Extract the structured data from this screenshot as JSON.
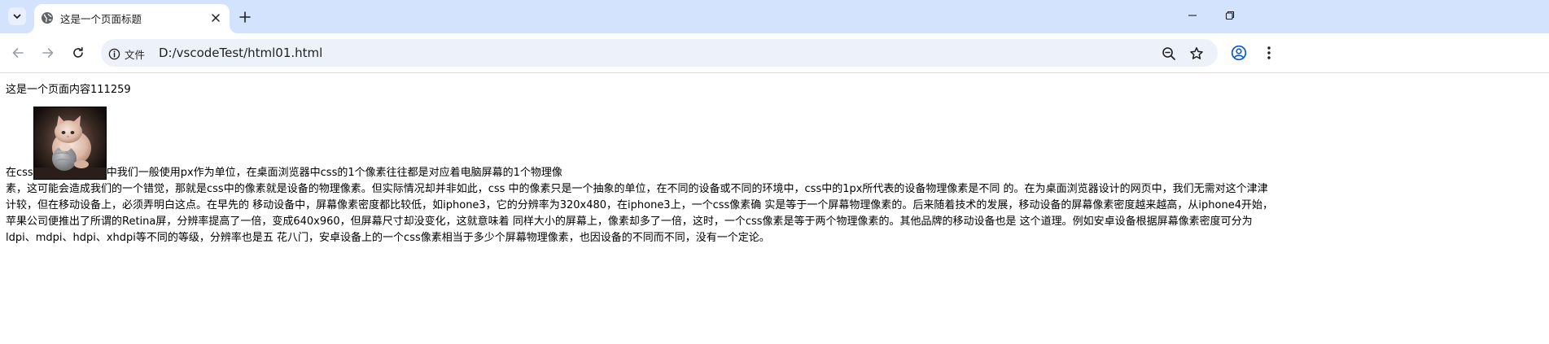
{
  "browser": {
    "tab": {
      "title": "这是一个页面标题"
    },
    "address_bar": {
      "site_label": "文件",
      "url": "D:/vscodeTest/html01.html"
    },
    "icons": {
      "tab_search": "chevron-down-icon",
      "favicon": "globe-icon",
      "close_tab": "close-icon",
      "new_tab": "plus-icon",
      "minimize": "minimize-icon",
      "restore": "restore-icon",
      "back": "arrow-left-icon",
      "forward": "arrow-right-icon",
      "reload": "reload-icon",
      "site_info": "info-icon",
      "zoom": "zoom-out-icon",
      "bookmark": "star-icon",
      "profile": "account-icon",
      "menu": "kebab-menu-icon"
    },
    "colors": {
      "tabstrip_bg": "#d3e3fd",
      "omnibox_bg": "#edf2fa"
    }
  },
  "page": {
    "heading_text": "这是一个页面内容111259",
    "paragraph": {
      "lead": "在css",
      "after_image": "中我们一般使用px作为单位，在桌面浏览器中css的1个像素往往都是对应着电脑屏幕的1个物理像",
      "lines": [
        "素，这可能会造成我们的一个错觉，那就是css中的像素就是设备的物理像素。但实际情况却并非如此，css 中的像素只是一个抽象的单位，在不同的设备或不同的环境中，css中的1px所代表的设备物理像素是不同 的。在为桌面浏览器设计的网页中，我们无需对这个津津",
        "计较，但在移动设备上，必须弄明白这点。在早先的 移动设备中，屏幕像素密度都比较低，如iphone3，它的分辨率为320x480，在iphone3上，一个css像素确 实是等于一个屏幕物理像素的。后来随着技术的发展，移动设备的屏幕像素密度越来越高，从iphone4开始，",
        "苹果公司便推出了所谓的Retina屏，分辨率提高了一倍，变成640x960，但屏幕尺寸却没变化，这就意味着 同样大小的屏幕上，像素却多了一倍，这时，一个css像素是等于两个物理像素的。其他品牌的移动设备也是 这个道理。例如安卓设备根据屏幕像素密度可分为",
        "ldpi、mdpi、hdpi、xhdpi等不同的等级，分辨率也是五 花八门，安卓设备上的一个css像素相当于多少个屏幕物理像素，也因设备的不同而不同，没有一个定论。"
      ]
    }
  }
}
